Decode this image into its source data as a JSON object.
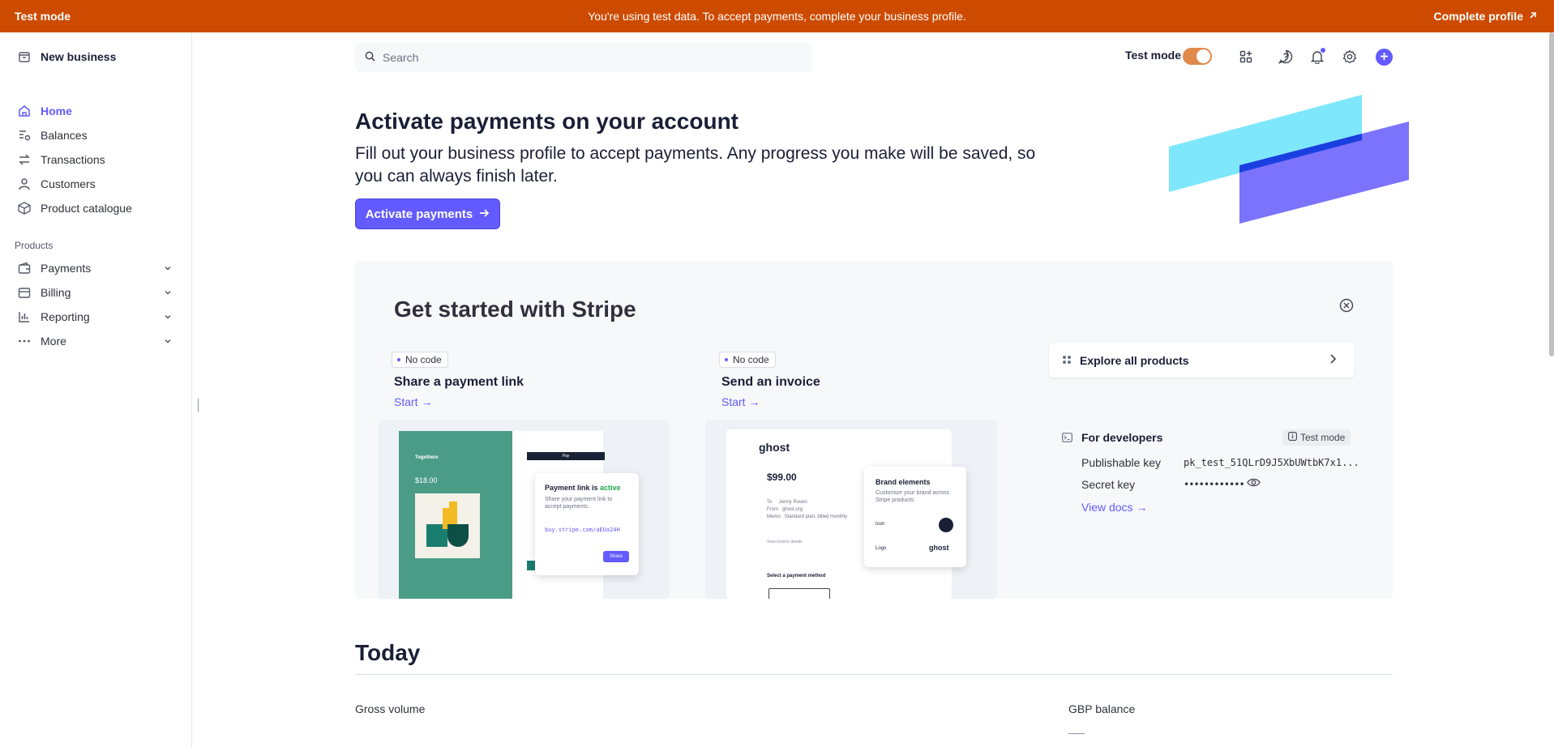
{
  "banner": {
    "left": "Test mode",
    "message": "You're using test data. To accept payments, complete your business profile.",
    "cta": "Complete profile"
  },
  "sidebar": {
    "account_name": "New business",
    "items": [
      {
        "label": "Home",
        "icon": "home-icon",
        "active": true
      },
      {
        "label": "Balances",
        "icon": "balances-icon"
      },
      {
        "label": "Transactions",
        "icon": "transactions-icon"
      },
      {
        "label": "Customers",
        "icon": "person-icon"
      },
      {
        "label": "Product catalogue",
        "icon": "box-icon"
      }
    ],
    "products_heading": "Products",
    "product_items": [
      {
        "label": "Payments",
        "icon": "wallet-icon"
      },
      {
        "label": "Billing",
        "icon": "billing-icon"
      },
      {
        "label": "Reporting",
        "icon": "chart-icon"
      },
      {
        "label": "More",
        "icon": "more-icon"
      }
    ]
  },
  "topbar": {
    "search_placeholder": "Search",
    "test_mode_label": "Test mode",
    "test_mode_on": true
  },
  "hero": {
    "title": "Activate payments on your account",
    "description": "Fill out your business profile to accept payments. Any progress you make will be saved, so you can always finish later.",
    "button": "Activate payments"
  },
  "get_started": {
    "title": "Get started with Stripe",
    "cards": [
      {
        "badge": "No code",
        "title": "Share a payment link",
        "link": "Start"
      },
      {
        "badge": "No code",
        "title": "Send an invoice",
        "link": "Start"
      }
    ],
    "payment_link_preview": {
      "status_prefix": "Payment link is",
      "status_word": "active",
      "subtext": "Share your payment link to accept payments.",
      "url": "buy.stripe.com/aEUa24H",
      "share": "Share",
      "brand": "Togethere",
      "price": "$18.00",
      "pay_button": "Pay"
    },
    "invoice_preview": {
      "brand": "ghost",
      "amount": "$99.00",
      "to_label": "To",
      "to_value": "Jenny Rosen",
      "from_label": "From",
      "from_value": "ghost.org",
      "memo_label": "Memo",
      "memo_value": "Standard plan, billed monthly",
      "view_details": "View invoice details",
      "select_method": "Select a payment method",
      "brand_elements_title": "Brand elements",
      "brand_elements_text": "Customize your brand across Stripe products.",
      "icon_label": "Icon",
      "logo_label": "Logo"
    },
    "explore": "Explore all products",
    "developers": {
      "title": "For developers",
      "badge": "Test mode",
      "publishable_label": "Publishable key",
      "publishable_value": "pk_test_51QLrD9J5XbUWtbK7x1...",
      "secret_label": "Secret key",
      "secret_value": "••••••••••••",
      "docs": "View docs"
    }
  },
  "today": {
    "title": "Today",
    "gross_volume": "Gross volume",
    "gbp_balance": "GBP balance"
  },
  "colors": {
    "banner": "#cd4b00",
    "accent": "#635bff",
    "panel_bg": "#f6f8fa"
  }
}
